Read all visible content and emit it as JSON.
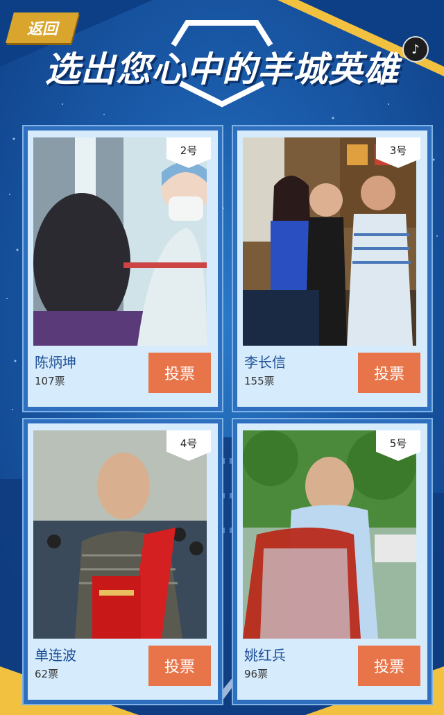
{
  "header": {
    "back_label": "返回",
    "title": "选出您心中的羊城英雄",
    "music_icon": "music-note-icon"
  },
  "colors": {
    "background": "#1a5aa8",
    "accent_yellow": "#f3c140",
    "card_bg": "#d6ebfb",
    "vote_button": "#e8754a",
    "name_text": "#1c4f97"
  },
  "candidates": [
    {
      "number": "2号",
      "name": "陈炳坤",
      "votes": "107票",
      "vote_label": "投票",
      "photo": "medical staff in protective mask"
    },
    {
      "number": "3号",
      "name": "李长信",
      "votes": "155票",
      "vote_label": "投票",
      "photo": "family of three seated"
    },
    {
      "number": "4号",
      "name": "单连波",
      "votes": "62票",
      "vote_label": "投票",
      "photo": "man with red sash and certificate"
    },
    {
      "number": "5号",
      "name": "姚红兵",
      "votes": "96票",
      "vote_label": "投票",
      "photo": "man standing beside red car"
    }
  ]
}
